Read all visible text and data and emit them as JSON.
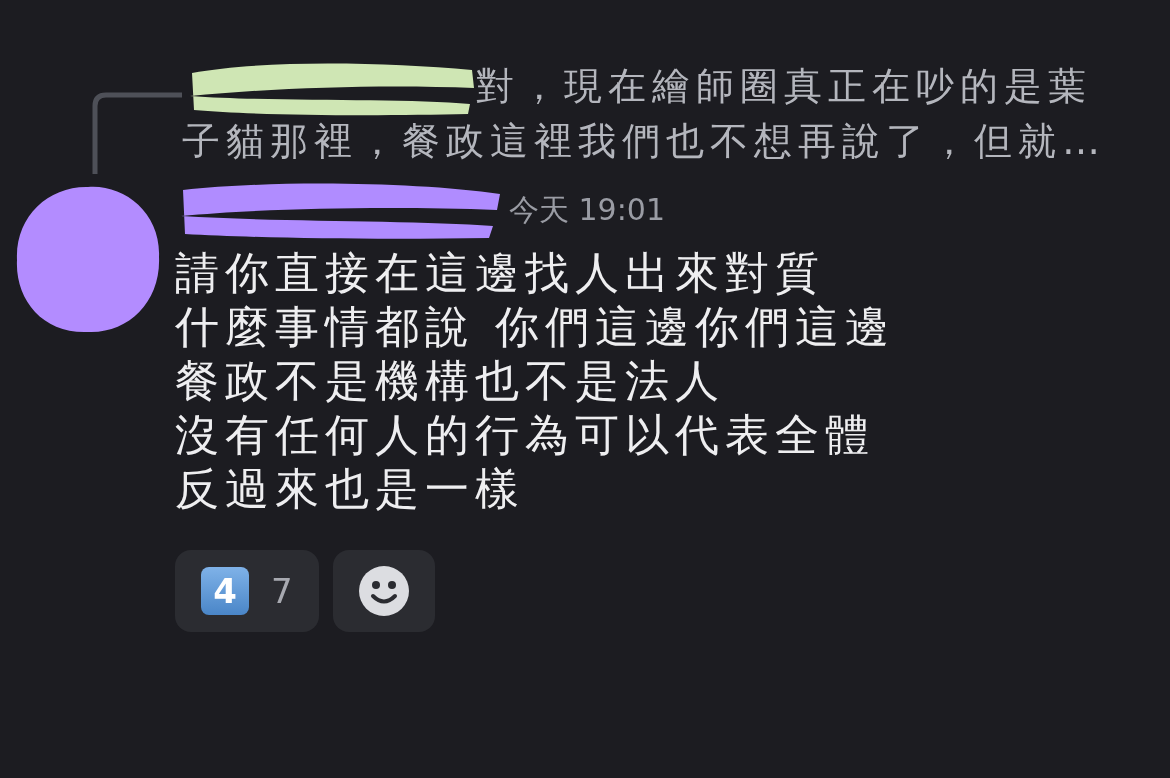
{
  "reply": {
    "text": "對，現在繪師圈真正在吵的是葉子貓那裡，餐政這裡我們也不想再說了，但就…"
  },
  "message": {
    "timestamp": "今天 19:01",
    "lines": [
      "請你直接在這邊找人出來對質",
      "什麼事情都說 你們這邊你們這邊",
      "餐政不是機構也不是法人",
      "沒有任何人的行為可以代表全體",
      "反過來也是一樣"
    ]
  },
  "reactions": [
    {
      "emoji": "4",
      "count": "7",
      "selected": false
    }
  ]
}
